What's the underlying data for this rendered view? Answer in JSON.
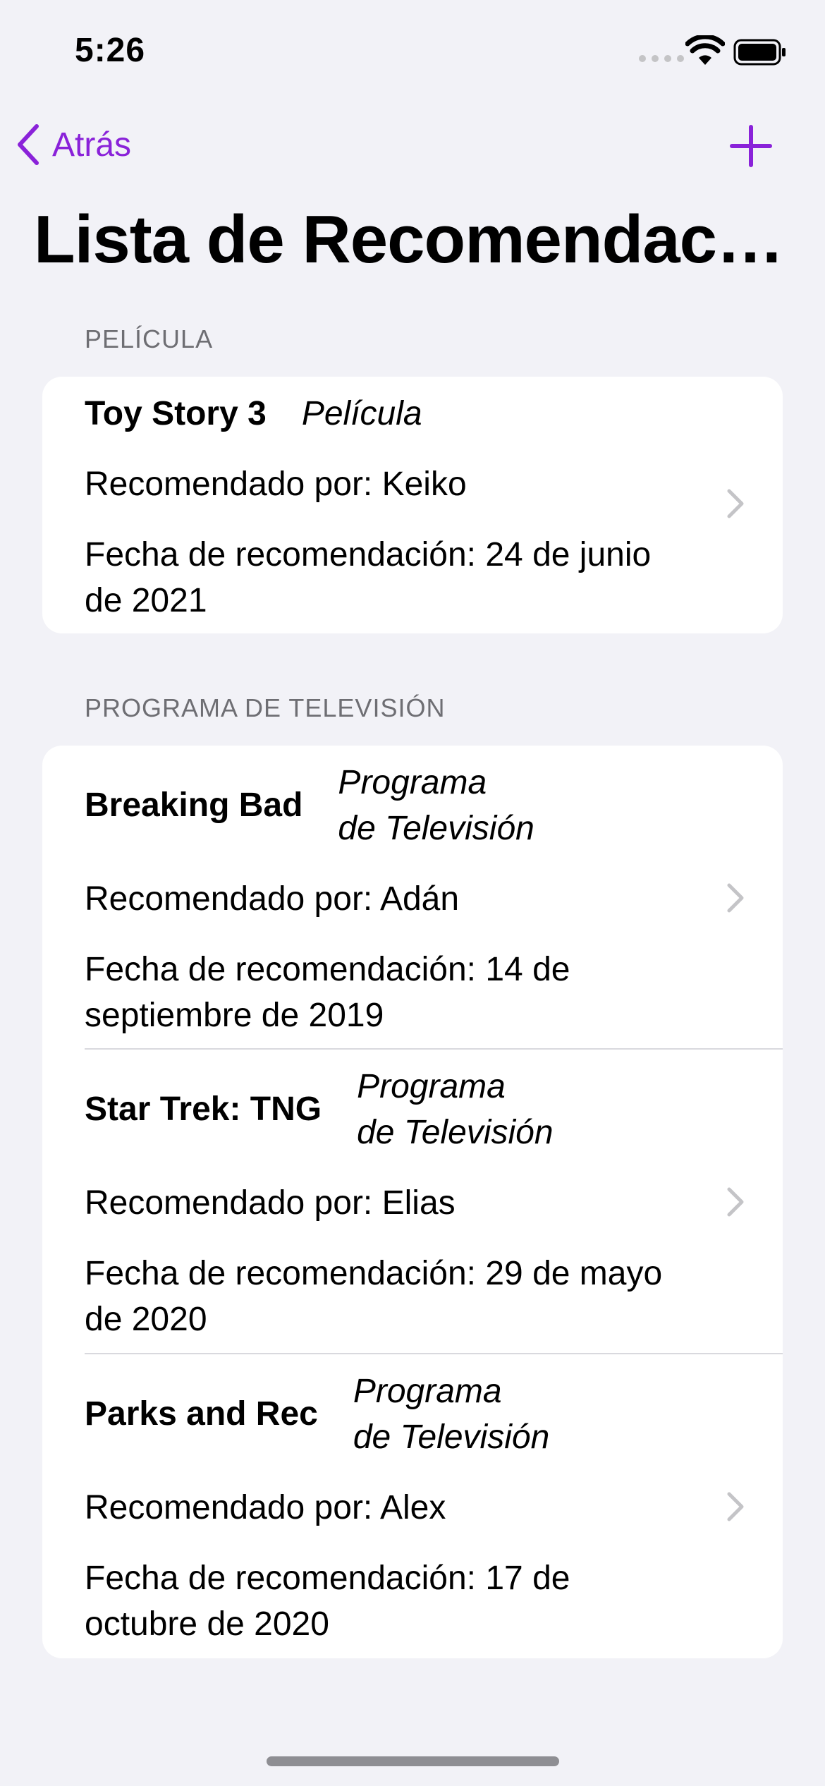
{
  "status_bar": {
    "time": "5:26"
  },
  "nav": {
    "back_label": "Atrás",
    "accent_color": "#8A22D9"
  },
  "title": "Lista de Recomendac…",
  "sections": [
    {
      "header": "PELÍCULA",
      "items": [
        {
          "title": "Toy Story 3",
          "type_line1": "Película",
          "type_line2": "",
          "recommended": "Recomendado por: Keiko",
          "date_line1": "Fecha de recomendación: 24 de junio",
          "date_line2": "de 2021"
        }
      ]
    },
    {
      "header": "PROGRAMA DE TELEVISIÓN",
      "items": [
        {
          "title": "Breaking Bad",
          "type_line1": "Programa",
          "type_line2": "de Televisión",
          "recommended": "Recomendado por: Adán",
          "date_line1": "Fecha de recomendación: 14 de",
          "date_line2": "septiembre de 2019"
        },
        {
          "title": "Star Trek: TNG",
          "type_line1": "Programa",
          "type_line2": "de Televisión",
          "recommended": "Recomendado por: Elias",
          "date_line1": "Fecha de recomendación: 29 de mayo",
          "date_line2": "de 2020"
        },
        {
          "title": "Parks and Rec",
          "type_line1": "Programa",
          "type_line2": "de Televisión",
          "recommended": "Recomendado por: Alex",
          "date_line1": "Fecha de recomendación: 17 de",
          "date_line2": "octubre de 2020"
        }
      ]
    }
  ]
}
